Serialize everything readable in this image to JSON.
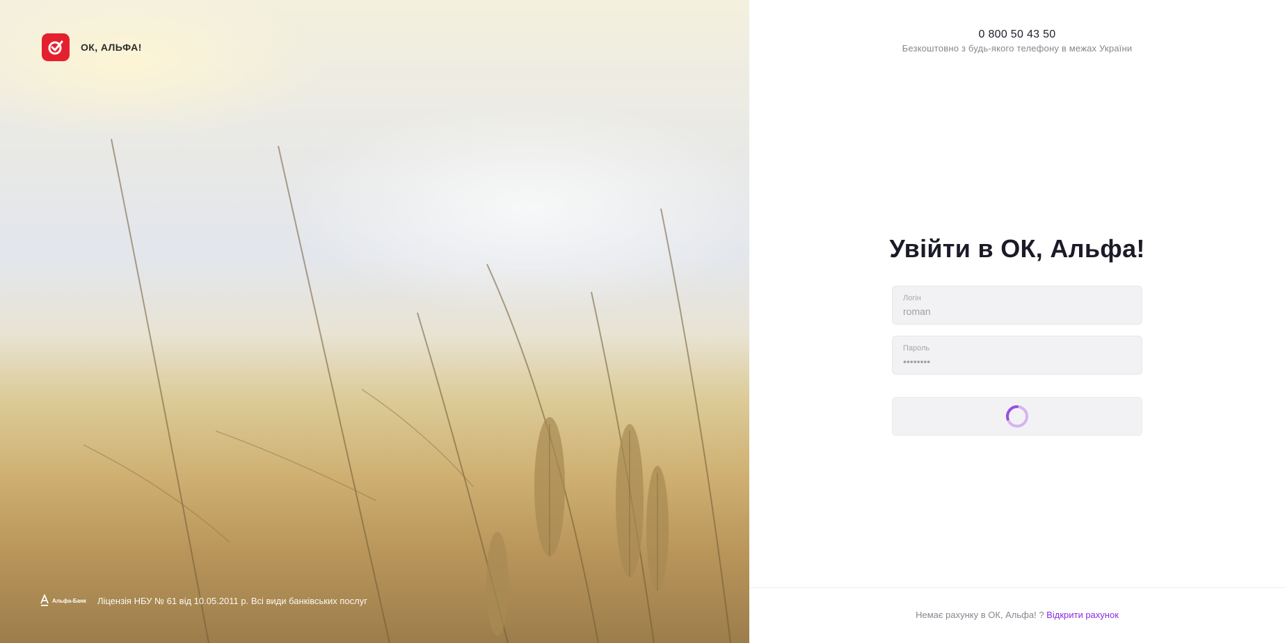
{
  "brand": {
    "name": "ОК, АЛЬФА!",
    "accent": "#e4202e",
    "logo_icon": "check-heart-icon"
  },
  "hero": {
    "bank_mark": "Альфа-Банк",
    "license": "Ліцензія НБУ № 61 від 10.05.2011 р. Всі види банківських послуг"
  },
  "contact": {
    "phone": "0 800 50 43 50",
    "note": "Безкоштовно з будь-якого телефону в межах України"
  },
  "login": {
    "title": "Увійти в ОК, Альфа!",
    "login_label": "Логін",
    "login_value": "roman",
    "password_label": "Пароль",
    "password_value": "••••••••",
    "submit_state": "loading",
    "spinner_color": "#b06ee6"
  },
  "footer": {
    "prompt": "Немає рахунку в ОК, Альфа! ?",
    "link": "Відкрити рахунок",
    "link_color": "#8a2be2"
  }
}
